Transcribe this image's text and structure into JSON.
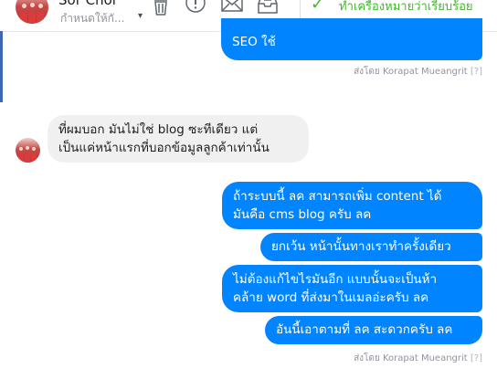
{
  "header": {
    "contact_name": "Sor Chor",
    "contact_sub": "กำหนดให้กั...",
    "caret": "▾",
    "toolbar_icons": [
      "trash-icon",
      "alert-icon",
      "mail-icon",
      "inbox-icon"
    ],
    "status_text": "ทำเครื่องหมายว่าเรียบร้อย",
    "status_color": "#42b72a"
  },
  "thread": {
    "first_bubble": "SEO ใช้",
    "sent_by_1": "ส่งโดย Korapat Mueangrit",
    "sent_by_1_help": "[?]",
    "incoming": {
      "line1": "ที่ผมบอก มันไม่ใช่ blog ซะทีเดียว  แต่",
      "line2": "เป็นแค่หน้าแรกที่บอกข้อมูลลูกค้าเท่านั้น"
    },
    "outgoing": [
      {
        "line1": "ถ้าระบบนี้ ลค สามารถเพิ่ม content ได้",
        "line2": "มันคือ cms blog ครับ ลค"
      },
      {
        "line1": "ยกเว้น หน้านั้นทางเราทำครั้งเดียว"
      },
      {
        "line1": "ไม่ต้องแก้ไขไรมันอีก แบบนั้นจะเป็นห้า",
        "line2": "คล้าย word ที่ส่งมาในเมลอ่ะครับ ลค"
      },
      {
        "line1": "อันนี้เอาตามที่ ลค สะดวกครับ ลค"
      }
    ],
    "sent_by_2": "ส่งโดย Korapat Mueangrit",
    "sent_by_2_help": "[?]",
    "bubble_color": "#0084ff"
  }
}
